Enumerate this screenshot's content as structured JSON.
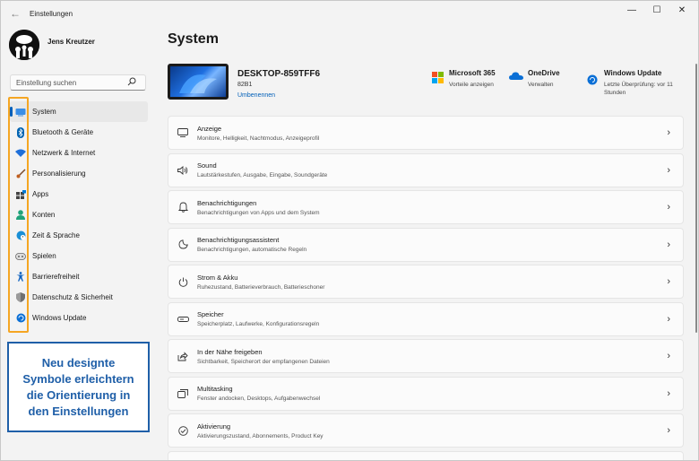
{
  "window": {
    "title": "Einstellungen",
    "back_icon": "←",
    "minimize": "—",
    "maximize": "☐",
    "close": "✕"
  },
  "profile": {
    "name": "Jens Kreutzer"
  },
  "search": {
    "placeholder": "Einstellung suchen"
  },
  "sidebar": {
    "items": [
      {
        "label": "System",
        "icon": "system-icon",
        "color": "#0078d4"
      },
      {
        "label": "Bluetooth & Geräte",
        "icon": "bluetooth-icon",
        "color": "#0063b1"
      },
      {
        "label": "Netzwerk & Internet",
        "icon": "wifi-icon",
        "color": "#1e6fd9"
      },
      {
        "label": "Personalisierung",
        "icon": "brush-icon",
        "color": "#c06020"
      },
      {
        "label": "Apps",
        "icon": "apps-icon",
        "color": "#444444"
      },
      {
        "label": "Konten",
        "icon": "account-icon",
        "color": "#1fa37a"
      },
      {
        "label": "Zeit & Sprache",
        "icon": "globe-clock-icon",
        "color": "#1a8fd6"
      },
      {
        "label": "Spielen",
        "icon": "gamepad-icon",
        "color": "#666666"
      },
      {
        "label": "Barrierefreiheit",
        "icon": "accessibility-icon",
        "color": "#0a5fbf"
      },
      {
        "label": "Datenschutz & Sicherheit",
        "icon": "shield-icon",
        "color": "#707070"
      },
      {
        "label": "Windows Update",
        "icon": "update-icon",
        "color": "#0a6fd6"
      }
    ]
  },
  "callout": {
    "text": "Neu designte\nSymbole erleichtern\ndie Orientierung in\nden Einstellungen"
  },
  "main": {
    "title": "System",
    "device": {
      "name": "DESKTOP-859TFF6",
      "model": "82B1",
      "rename": "Umbenennen"
    },
    "quick_links": [
      {
        "title": "Microsoft 365",
        "sub": "Vorteile anzeigen",
        "icon": "microsoft365-icon"
      },
      {
        "title": "OneDrive",
        "sub": "Verwalten",
        "icon": "onedrive-icon"
      },
      {
        "title": "Windows Update",
        "sub": "Letzte Überprüfung: vor 11\nStunden",
        "icon": "update-icon"
      }
    ],
    "cards": [
      {
        "title": "Anzeige",
        "sub": "Monitore, Helligkeit, Nachtmodus, Anzeigeprofil",
        "icon": "display-icon"
      },
      {
        "title": "Sound",
        "sub": "Lautstärkestufen, Ausgabe, Eingabe, Soundgeräte",
        "icon": "speaker-icon"
      },
      {
        "title": "Benachrichtigungen",
        "sub": "Benachrichtigungen von Apps und dem System",
        "icon": "bell-icon"
      },
      {
        "title": "Benachrichtigungsassistent",
        "sub": "Benachrichtigungen, automatische Regeln",
        "icon": "moon-icon"
      },
      {
        "title": "Strom & Akku",
        "sub": "Ruhezustand, Batterieverbrauch, Batterieschoner",
        "icon": "power-icon"
      },
      {
        "title": "Speicher",
        "sub": "Speicherplatz, Laufwerke, Konfigurationsregeln",
        "icon": "storage-icon"
      },
      {
        "title": "In der Nähe freigeben",
        "sub": "Sichtbarkeit, Speicherort der empfangenen Dateien",
        "icon": "share-icon"
      },
      {
        "title": "Multitasking",
        "sub": "Fenster andocken, Desktops, Aufgabenwechsel",
        "icon": "multitasking-icon"
      },
      {
        "title": "Aktivierung",
        "sub": "Aktivierungszustand, Abonnements, Product Key",
        "icon": "check-circle-icon"
      }
    ],
    "chevron": "›"
  }
}
